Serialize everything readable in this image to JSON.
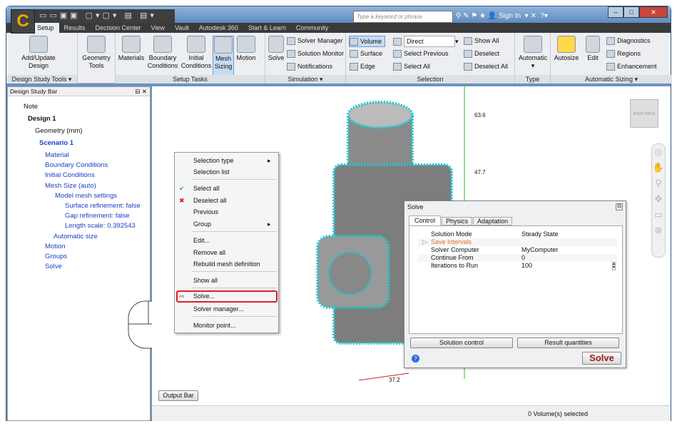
{
  "titlebar": {
    "search_placeholder": "Type a keyword or phrase",
    "sign_in": "Sign In"
  },
  "tabs": [
    "Setup",
    "Results",
    "Decision Center",
    "View",
    "Vault",
    "Autodesk 360",
    "Start & Learn",
    "Community"
  ],
  "ribbon": {
    "design_study_tools": {
      "label": "Design Study Tools ▾",
      "add_update": "Add/Update",
      "design": "Design"
    },
    "geometry": {
      "l1": "Geometry",
      "l2": "Tools"
    },
    "setup_tasks": {
      "label": "Setup Tasks",
      "materials": "Materials",
      "bc1": "Boundary",
      "bc2": "Conditions",
      "ic1": "Initial",
      "ic2": "Conditions",
      "ms1": "Mesh",
      "ms2": "Sizing",
      "motion": "Motion"
    },
    "simulation": {
      "label": "Simulation ▾",
      "solve": "Solve",
      "solver_manager": "Solver Manager",
      "solution_monitor": "Solution Monitor",
      "notifications": "Notifications"
    },
    "selection": {
      "label": "Selection",
      "volume": "Volume",
      "surface": "Surface",
      "edge": "Edge",
      "mode": "Direct",
      "select_previous": "Select Previous",
      "select_all": "Select All",
      "show_all": "Show All",
      "deselect": "Deselect",
      "deselect_all": "Deselect All"
    },
    "type": {
      "label": "Type",
      "automatic": "Automatic"
    },
    "automatic_sizing": {
      "label": "Automatic Sizing ▾",
      "autosize": "Autosize",
      "edit": "Edit",
      "diagnostics": "Diagnostics",
      "regions": "Regions",
      "enhancement": "Enhancement"
    }
  },
  "panel": {
    "title": "Design Study Bar",
    "tree": [
      "Note",
      "Design 1",
      "Geometry (mm)",
      "Scenario 1",
      "Material",
      "Boundary Conditions",
      "Initial Conditions",
      "Mesh Size (auto)",
      "Model mesh settings",
      "Surface refinement: false",
      "Gap refinement: false",
      "Length scale: 0.392543",
      "Automatic size",
      "Motion",
      "Groups",
      "Solve"
    ]
  },
  "context_menu": [
    "Selection type",
    "Selection list",
    "Select all",
    "Deselect all",
    "Previous",
    "Group",
    "Edit...",
    "Remove all",
    "Rebuild mesh definition",
    "Show all",
    "Solve...",
    "Solver manager...",
    "Monitor point..."
  ],
  "axis_labels": [
    "63.6",
    "47.7",
    "37.2"
  ],
  "viewcube": {
    "right": "RIGHT",
    "back": "BACK"
  },
  "dialog": {
    "title": "Solve",
    "tabs": [
      "Control",
      "Physics",
      "Adaptation"
    ],
    "rows": [
      {
        "k": "Solution Mode",
        "v": "Steady State"
      },
      {
        "k": "Save Intervals",
        "v": ""
      },
      {
        "k": "Solver Computer",
        "v": "MyComputer"
      },
      {
        "k": "Continue From",
        "v": "0"
      },
      {
        "k": "Iterations to Run",
        "v": "100"
      }
    ],
    "solution_control": "Solution control",
    "result_quantities": "Result quantities",
    "solve": "Solve"
  },
  "output_bar": "Output Bar",
  "status": "0 Volume(s) selected",
  "colors": {
    "mesh": "#1ec8d4",
    "highlight": "#e02020",
    "solve_text": "#a01818"
  }
}
